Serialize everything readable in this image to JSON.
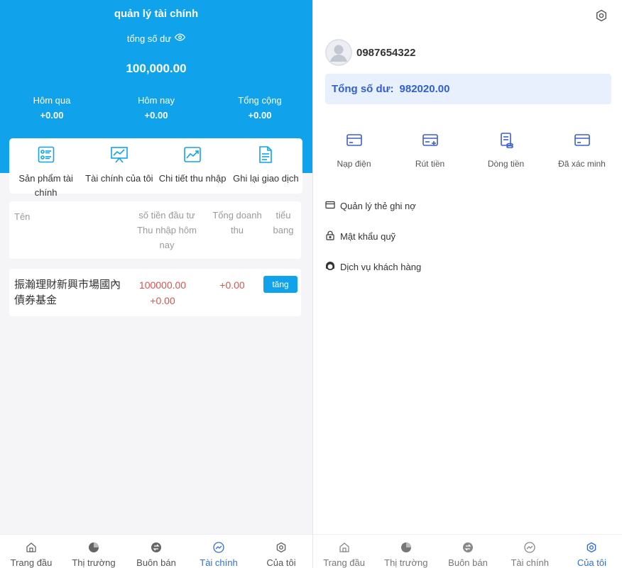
{
  "left": {
    "header": {
      "title": "quản lý tài chính",
      "balance_label": "tổng số dư",
      "balance_value": "100,000.00",
      "stats": [
        {
          "label": "Hôm qua",
          "value": "+0.00"
        },
        {
          "label": "Hôm nay",
          "value": "+0.00"
        },
        {
          "label": "Tổng cộng",
          "value": "+0.00"
        }
      ]
    },
    "shortcuts": [
      {
        "label": "Sản phẩm tài chính",
        "icon": "product-list-icon"
      },
      {
        "label": "Tài chính của tôi",
        "icon": "presentation-chart-icon"
      },
      {
        "label": "Chi tiết thu nhập",
        "icon": "trend-chart-icon"
      },
      {
        "label": "Ghi lại giao dịch",
        "icon": "document-icon"
      }
    ],
    "table": {
      "headers": {
        "name": "Tên",
        "investment": "số tiền đầu tư Thu nhập hôm nay",
        "revenue": "Tổng doanh thu",
        "status": "tiểu bang"
      },
      "rows": [
        {
          "name": "振瀚理財新興市場國內債券基金",
          "amount": "100000.00",
          "today": "+0.00",
          "revenue": "+0.00",
          "action": "tăng"
        }
      ]
    }
  },
  "tabs": [
    {
      "label": "Trang đầu",
      "icon": "home-icon"
    },
    {
      "label": "Thị trường",
      "icon": "pie-chart-icon"
    },
    {
      "label": "Buôn bán",
      "icon": "exchange-icon"
    },
    {
      "label": "Tài chính",
      "icon": "finance-icon"
    },
    {
      "label": "Của tôi",
      "icon": "gear-icon"
    }
  ],
  "left_active_tab": "Tài chính",
  "right_active_tab": "Của tôi",
  "right": {
    "phone": "0987654322",
    "balance_label": "Tổng số dư:",
    "balance_value": "982020.00",
    "actions": [
      {
        "label": "Nạp điện",
        "icon": "card-icon"
      },
      {
        "label": "Rút tiền",
        "icon": "card-withdraw-icon"
      },
      {
        "label": "Dòng tiền",
        "icon": "cash-flow-icon"
      },
      {
        "label": "Đã xác minh",
        "icon": "card-verified-icon"
      }
    ],
    "menu": [
      {
        "label": "Quản lý thẻ ghi nợ",
        "icon": "debit-card-icon"
      },
      {
        "label": "Mật khẩu quỹ",
        "icon": "lock-icon"
      },
      {
        "label": "Dịch vụ khách hàng",
        "icon": "headset-icon"
      }
    ]
  },
  "colors": {
    "primary": "#10a3ec",
    "accent_blue": "#2f6fd6",
    "negative": "#d9534f",
    "balance_card": "#e9f0fd"
  }
}
